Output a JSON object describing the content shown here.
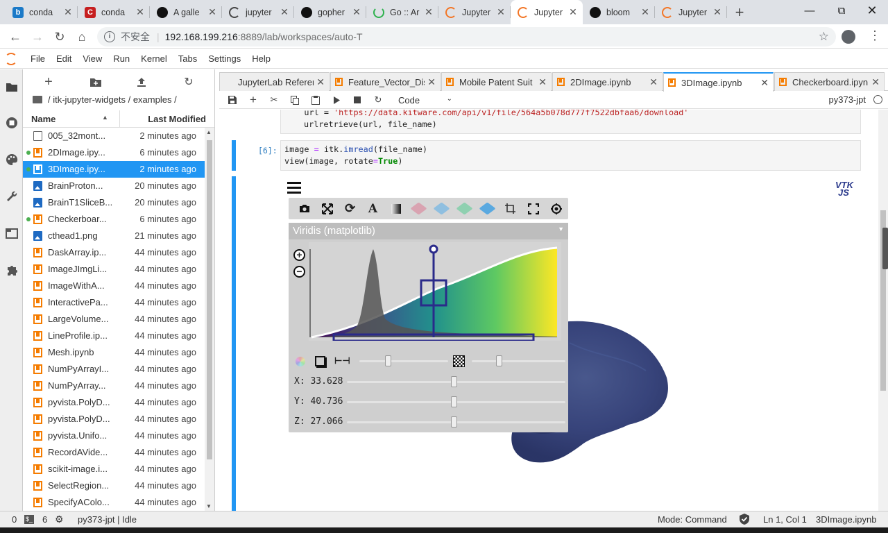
{
  "browser": {
    "tabs": [
      {
        "label": "conda",
        "favicon": "bing-icon",
        "color": "#1b7ac8"
      },
      {
        "label": "conda",
        "favicon": "c-icon",
        "color": "#c61f20"
      },
      {
        "label": "A galle",
        "favicon": "github-icon",
        "color": "#111111"
      },
      {
        "label": "jupyter",
        "favicon": "jupyter-icon",
        "color": "#444444"
      },
      {
        "label": "gopher",
        "favicon": "github-icon",
        "color": "#111111"
      },
      {
        "label": "Go :: Ar",
        "favicon": "loading-icon",
        "color": "#2db14d"
      },
      {
        "label": "Jupyter",
        "favicon": "jupyter-icon",
        "color": "#f37626"
      },
      {
        "label": "Jupyter",
        "favicon": "jupyter-icon",
        "color": "#f37626",
        "active": true
      },
      {
        "label": "bloom",
        "favicon": "github-icon",
        "color": "#111111"
      },
      {
        "label": "Jupyter",
        "favicon": "jupyter-icon",
        "color": "#f37626"
      }
    ],
    "security_label": "不安全",
    "url_host": "192.168.199.216",
    "url_path": ":8889/lab/workspaces/auto-T"
  },
  "menu": [
    "File",
    "Edit",
    "View",
    "Run",
    "Kernel",
    "Tabs",
    "Settings",
    "Help"
  ],
  "filebrowser": {
    "breadcrumb": "/ itk-jupyter-widgets / examples /",
    "col_name": "Name",
    "col_modified": "Last Modified",
    "files": [
      {
        "name": "005_32mont...",
        "modified": "2 minutes ago",
        "type": "file",
        "running": false,
        "selected": false
      },
      {
        "name": "2DImage.ipy...",
        "modified": "6 minutes ago",
        "type": "notebook",
        "running": true,
        "selected": false
      },
      {
        "name": "3DImage.ipy...",
        "modified": "2 minutes ago",
        "type": "notebook",
        "running": true,
        "selected": true
      },
      {
        "name": "BrainProton...",
        "modified": "20 minutes ago",
        "type": "image",
        "running": false,
        "selected": false
      },
      {
        "name": "BrainT1SliceB...",
        "modified": "20 minutes ago",
        "type": "image",
        "running": false,
        "selected": false
      },
      {
        "name": "Checkerboar...",
        "modified": "6 minutes ago",
        "type": "notebook",
        "running": true,
        "selected": false
      },
      {
        "name": "cthead1.png",
        "modified": "21 minutes ago",
        "type": "image",
        "running": false,
        "selected": false
      },
      {
        "name": "DaskArray.ip...",
        "modified": "44 minutes ago",
        "type": "notebook",
        "running": false,
        "selected": false
      },
      {
        "name": "ImageJImgLi...",
        "modified": "44 minutes ago",
        "type": "notebook",
        "running": false,
        "selected": false
      },
      {
        "name": "ImageWithA...",
        "modified": "44 minutes ago",
        "type": "notebook",
        "running": false,
        "selected": false
      },
      {
        "name": "InteractivePa...",
        "modified": "44 minutes ago",
        "type": "notebook",
        "running": false,
        "selected": false
      },
      {
        "name": "LargeVolume...",
        "modified": "44 minutes ago",
        "type": "notebook",
        "running": false,
        "selected": false
      },
      {
        "name": "LineProfile.ip...",
        "modified": "44 minutes ago",
        "type": "notebook",
        "running": false,
        "selected": false
      },
      {
        "name": "Mesh.ipynb",
        "modified": "44 minutes ago",
        "type": "notebook",
        "running": false,
        "selected": false
      },
      {
        "name": "NumPyArrayI...",
        "modified": "44 minutes ago",
        "type": "notebook",
        "running": false,
        "selected": false
      },
      {
        "name": "NumPyArray...",
        "modified": "44 minutes ago",
        "type": "notebook",
        "running": false,
        "selected": false
      },
      {
        "name": "pyvista.PolyD...",
        "modified": "44 minutes ago",
        "type": "notebook",
        "running": false,
        "selected": false
      },
      {
        "name": "pyvista.PolyD...",
        "modified": "44 minutes ago",
        "type": "notebook",
        "running": false,
        "selected": false
      },
      {
        "name": "pyvista.Unifo...",
        "modified": "44 minutes ago",
        "type": "notebook",
        "running": false,
        "selected": false
      },
      {
        "name": "RecordAVide...",
        "modified": "44 minutes ago",
        "type": "notebook",
        "running": false,
        "selected": false
      },
      {
        "name": "scikit-image.i...",
        "modified": "44 minutes ago",
        "type": "notebook",
        "running": false,
        "selected": false
      },
      {
        "name": "SelectRegion...",
        "modified": "44 minutes ago",
        "type": "notebook",
        "running": false,
        "selected": false
      },
      {
        "name": "SpecifyAColo...",
        "modified": "44 minutes ago",
        "type": "notebook",
        "running": false,
        "selected": false
      }
    ]
  },
  "doc_tabs": [
    {
      "label": "JupyterLab Referen",
      "icon": false
    },
    {
      "label": "Feature_Vector_Dis",
      "icon": true
    },
    {
      "label": "Mobile Patent Suit",
      "icon": true
    },
    {
      "label": "2DImage.ipynb",
      "icon": true
    },
    {
      "label": "3DImage.ipynb",
      "icon": true,
      "active": true
    },
    {
      "label": "Checkerboard.ipyn",
      "icon": true
    }
  ],
  "notebook": {
    "cell_type": "Code",
    "kernel": "py373-jpt",
    "prev_cell": {
      "line1_a": "url = ",
      "line1_str": "'https://data.kitware.com/api/v1/file/564a5b078d777f7522dbfaa6/download'",
      "line2": "urlretrieve(url, file_name)"
    },
    "cell": {
      "prompt": "[6]:",
      "l1_var": "image ",
      "l1_eq": "=",
      "l1_mid": " itk.",
      "l1_fn": "imread",
      "l1_end": "(file_name)",
      "l2_start": "view(image, rotate",
      "l2_eq": "=",
      "l2_kw": "True",
      "l2_end": ")"
    }
  },
  "widget": {
    "logo_top": "VTK",
    "logo_bottom": "JS",
    "colormap_name": "Viridis (matplotlib)",
    "x_label": "X: 33.628",
    "y_label": "Y: 40.736",
    "z_label": "Z: 27.066",
    "x_slice": 0.49,
    "y_slice": 0.49,
    "z_slice": 0.49
  },
  "status": {
    "terminals": "0",
    "kernels": "6",
    "kernel_status": "py373-jpt | Idle",
    "mode": "Mode: Command",
    "cursor": "Ln 1, Col 1",
    "file": "3DImage.ipynb"
  }
}
